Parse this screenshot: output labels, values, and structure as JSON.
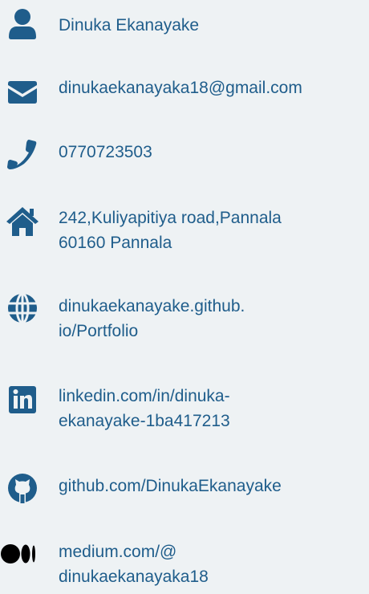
{
  "contacts": {
    "name": "Dinuka Ekanayake",
    "email": "dinukaekanayaka18@gmail.com",
    "phone": "0770723503",
    "address_line1": "242,Kuliyapitiya road,Pannala",
    "address_line2": "60160 Pannala",
    "website_line1": "dinukaekanayake.github.",
    "website_line2": "io/Portfolio",
    "linkedin_line1": "linkedin.com/in/dinuka-",
    "linkedin_line2": "ekanayake-1ba417213",
    "github": "github.com/DinukaEkanayake",
    "medium_line1": "medium.com/@",
    "medium_line2": "dinukaekanayaka18"
  },
  "icons": [
    "user-icon",
    "envelope-icon",
    "phone-icon",
    "home-icon",
    "globe-icon",
    "linkedin-icon",
    "github-icon",
    "medium-icon"
  ],
  "colors": {
    "accent": "#1f5d8b",
    "background": "#eef2f4",
    "medium_icon": "#000000"
  }
}
